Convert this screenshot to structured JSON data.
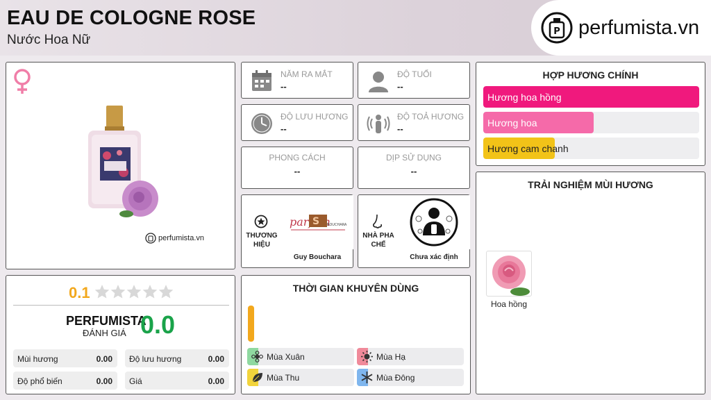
{
  "header": {
    "title": "EAU DE COLOGNE ROSE",
    "subtitle": "Nước Hoa Nữ",
    "logo_text": "perfumista.vn"
  },
  "product": {
    "gender_icon": "female-icon",
    "watermark": "perfumista.vn"
  },
  "info": {
    "release_year": {
      "title": "NĂM RA MẮT",
      "value": "--"
    },
    "age": {
      "title": "ĐỘ TUỔI",
      "value": "--"
    },
    "longevity": {
      "title": "ĐỘ LƯU HƯƠNG",
      "value": "--"
    },
    "sillage": {
      "title": "ĐỘ TOẢ HƯƠNG",
      "value": "--"
    },
    "style": {
      "title": "PHONG CÁCH",
      "value": "--"
    },
    "occasion": {
      "title": "DỊP SỬ DỤNG",
      "value": "--"
    }
  },
  "brand": {
    "label_line1": "THƯƠNG",
    "label_line2": "HIỆU",
    "name": "Guy Bouchara"
  },
  "perfumer": {
    "label_line1": "NHÀ PHA",
    "label_line2": "CHẾ",
    "name": "Chưa xác định"
  },
  "accords": {
    "title": "HỢP HƯƠNG CHÍNH",
    "items": [
      {
        "label": "Hương hoa hồng",
        "level": 1.0,
        "color": "#f0197d",
        "text_color": "#ffffff"
      },
      {
        "label": "Hương hoa",
        "level": 0.51,
        "color": "#f56aa9",
        "text_color": "#ffffff"
      },
      {
        "label": "Hương cam chanh",
        "level": 0.33,
        "color": "#f2c318",
        "text_color": "#222222"
      }
    ]
  },
  "experience": {
    "title": "TRẢI NGHIỆM MÙI HƯƠNG",
    "notes": [
      {
        "label": "Hoa hồng"
      }
    ]
  },
  "rating": {
    "user_score": "0.1",
    "stars_filled": 0,
    "stars_total": 5,
    "brand_label": "PERFUMISTA",
    "brand_sub": "ĐÁNH GIÁ",
    "brand_score": "0.0",
    "stats": [
      {
        "label": "Mùi hương",
        "value": "0.00"
      },
      {
        "label": "Độ lưu hương",
        "value": "0.00"
      },
      {
        "label": "Độ phổ biến",
        "value": "0.00"
      },
      {
        "label": "Giá",
        "value": "0.00"
      }
    ]
  },
  "time": {
    "title": "THỜI GIAN KHUYÊN DÙNG",
    "seasons": [
      {
        "label": "Mùa Xuân",
        "color": "#8fd9a0",
        "icon": "flower-icon"
      },
      {
        "label": "Mùa Hạ",
        "color": "#f08a9a",
        "icon": "sun-icon"
      },
      {
        "label": "Mùa Thu",
        "color": "#f2d43c",
        "icon": "leaf-icon"
      },
      {
        "label": "Mùa Đông",
        "color": "#7fb6ee",
        "icon": "snowflake-icon"
      }
    ]
  },
  "colors": {
    "gold": "#f2a81d",
    "green": "#1aa34a",
    "orange_bar": "#f2a81d"
  }
}
